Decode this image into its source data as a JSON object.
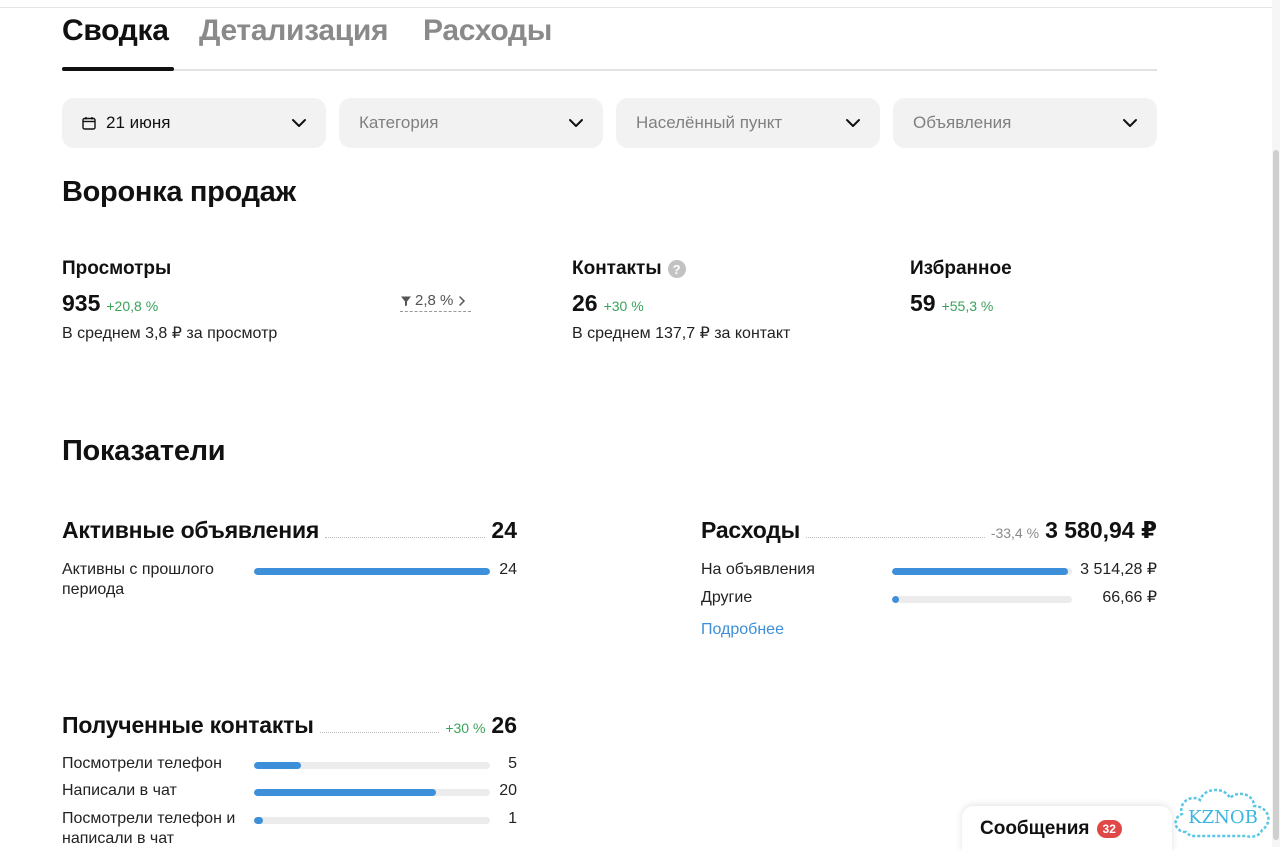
{
  "tabs": [
    {
      "label": "Сводка",
      "active": true
    },
    {
      "label": "Детализация",
      "active": false
    },
    {
      "label": "Расходы",
      "active": false
    }
  ],
  "filters": {
    "date": {
      "value": "21 июня",
      "icon": "calendar-icon"
    },
    "category": {
      "placeholder": "Категория"
    },
    "location": {
      "placeholder": "Населённый пункт"
    },
    "ads": {
      "placeholder": "Объявления"
    }
  },
  "funnel": {
    "title": "Воронка продаж",
    "views": {
      "label": "Просмотры",
      "value": "935",
      "delta": "+20,8 %",
      "sub": "В среднем 3,8 ₽ за просмотр"
    },
    "conversion": {
      "value": "2,8 %",
      "icon": "funnel-icon"
    },
    "contacts": {
      "label": "Контакты",
      "help": "?",
      "value": "26",
      "delta": "+30 %",
      "sub": "В среднем 137,7 ₽ за контакт"
    },
    "favorites": {
      "label": "Избранное",
      "value": "59",
      "delta": "+55,3 %"
    }
  },
  "indicators": {
    "title": "Показатели",
    "active_ads": {
      "title": "Активные объявления",
      "value": "24",
      "rows": [
        {
          "label": "Активны с прошлого периода",
          "value": "24",
          "fraction": 1.0
        }
      ]
    },
    "expenses": {
      "title": "Расходы",
      "delta": "-33,4 %",
      "value": "3 580,94 ₽",
      "rows": [
        {
          "label": "На объявления",
          "value": "3 514,28 ₽",
          "fraction": 0.98
        },
        {
          "label": "Другие",
          "value": "66,66 ₽",
          "fraction": 0.04
        }
      ],
      "more_link": "Подробнее"
    },
    "contacts": {
      "title": "Полученные контакты",
      "delta": "+30 %",
      "value": "26",
      "rows": [
        {
          "label": "Посмотрели телефон",
          "value": "5",
          "fraction": 0.2
        },
        {
          "label": "Написали в чат",
          "value": "20",
          "fraction": 0.77
        },
        {
          "label": "Посмотрели телефон и написали в чат",
          "value": "1",
          "fraction": 0.04
        }
      ]
    }
  },
  "messages": {
    "label": "Сообщения",
    "count": "32"
  },
  "colors": {
    "accent": "#3c8fd8",
    "positive": "#3aa35a",
    "negative": "#8a8a8a",
    "badge": "#e04848"
  }
}
